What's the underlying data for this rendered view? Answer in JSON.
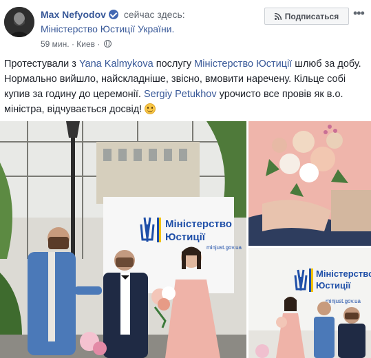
{
  "post": {
    "author": "Max Nefyodov",
    "status_text": "сейчас здесь:",
    "location_link": "Міністерство Юстиції України.",
    "time": "59 мин.",
    "separator": "·",
    "place": "Киев",
    "separator2": "·",
    "privacy_icon": "globe-icon",
    "verified_icon": "verified-badge-icon",
    "body": {
      "p1": "Протестували з ",
      "mention1": "Yana Kalmykova",
      "p2": " послугу ",
      "mention2": "Міністерство Юстиції",
      "p3": " шлюб за добу. Нормально вийшло, найскладніше, звісно, вмовити наречену. Кільце собі купив за годину до церемонії. ",
      "mention3": "Sergiy Petukhov",
      "p4": " урочисто все провів як в.о. міністра, відчувається досвід! ",
      "emoji": "smile-emoji"
    }
  },
  "actions": {
    "subscribe_label": "Подписаться",
    "subscribe_icon": "rss-icon",
    "more_label": "•••"
  },
  "photos": {
    "main": {
      "banner_line1": "Міністерство",
      "banner_line2": "Юстиції",
      "banner_url": "minjust.gov.ua"
    },
    "bottom": {
      "banner_line1": "Міністерство",
      "banner_line2": "Юстиції",
      "banner_url": "minjust.gov.ua"
    }
  },
  "colors": {
    "link": "#385898",
    "text": "#1d2129",
    "muted": "#606770",
    "verified": "#4267b2",
    "ukraine_blue": "#1f4fa8",
    "ukraine_yellow": "#f2c200"
  }
}
